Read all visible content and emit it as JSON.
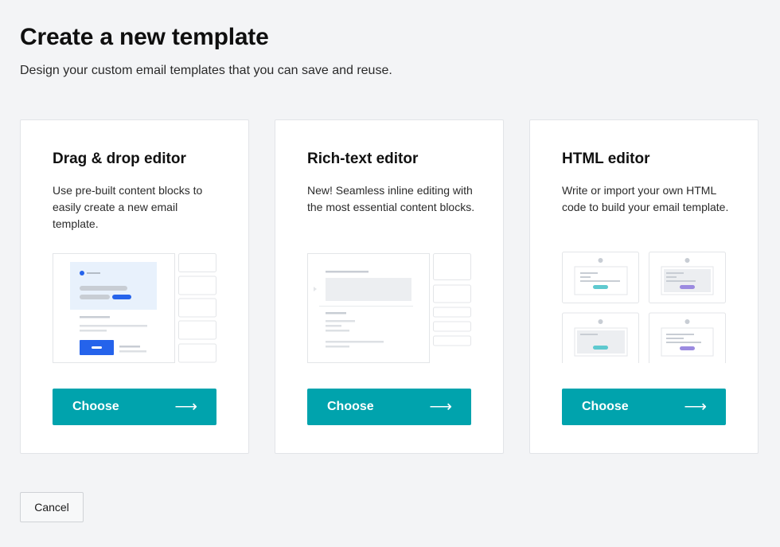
{
  "header": {
    "title": "Create a new template",
    "subtitle": "Design your custom email templates that you can save and reuse."
  },
  "cards": [
    {
      "title": "Drag & drop editor",
      "description": "Use pre-built content blocks to easily create a new email template.",
      "button_label": "Choose",
      "button_icon": "arrow-right-icon"
    },
    {
      "title": "Rich-text editor",
      "description": "New! Seamless inline editing with the most essential content blocks.",
      "button_label": "Choose",
      "button_icon": "arrow-right-icon"
    },
    {
      "title": "HTML editor",
      "description": "Write or import your own HTML code to build your email template.",
      "button_label": "Choose",
      "button_icon": "arrow-right-icon"
    }
  ],
  "footer": {
    "cancel_label": "Cancel"
  },
  "colors": {
    "accent": "#00a3ad",
    "blue": "#2563eb",
    "teal_bar": "#5ec9cf",
    "purple_bar": "#9b8ae0",
    "background": "#f3f4f6"
  }
}
